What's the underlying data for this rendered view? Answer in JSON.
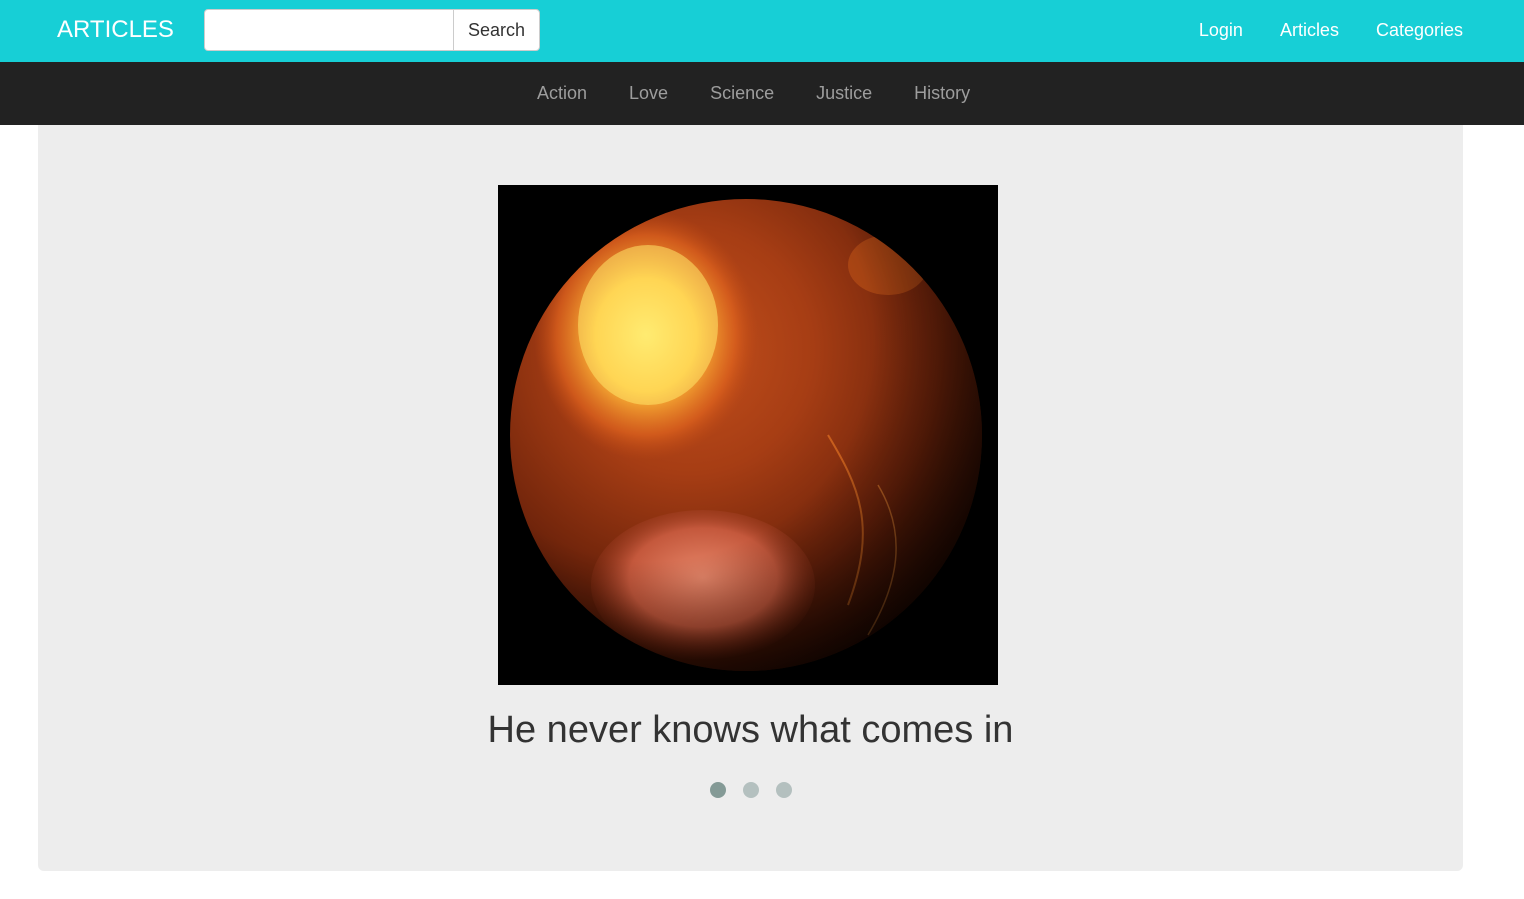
{
  "navbar": {
    "brand": "ARTICLES",
    "search": {
      "value": "",
      "placeholder": "",
      "button_label": "Search"
    },
    "links": [
      {
        "label": "Login"
      },
      {
        "label": "Articles"
      },
      {
        "label": "Categories"
      }
    ]
  },
  "categories": [
    {
      "label": "Action"
    },
    {
      "label": "Love"
    },
    {
      "label": "Science"
    },
    {
      "label": "Justice"
    },
    {
      "label": "History"
    }
  ],
  "carousel": {
    "caption": "He never knows what comes in",
    "image_subject": "molten-planet",
    "slide_count": 3,
    "active_index": 0
  },
  "colors": {
    "navbar_bg": "#17cfd6",
    "category_bar_bg": "#222222",
    "panel_bg": "#ededed",
    "dot_active": "#849a96",
    "dot_inactive": "#b4c0bf"
  }
}
